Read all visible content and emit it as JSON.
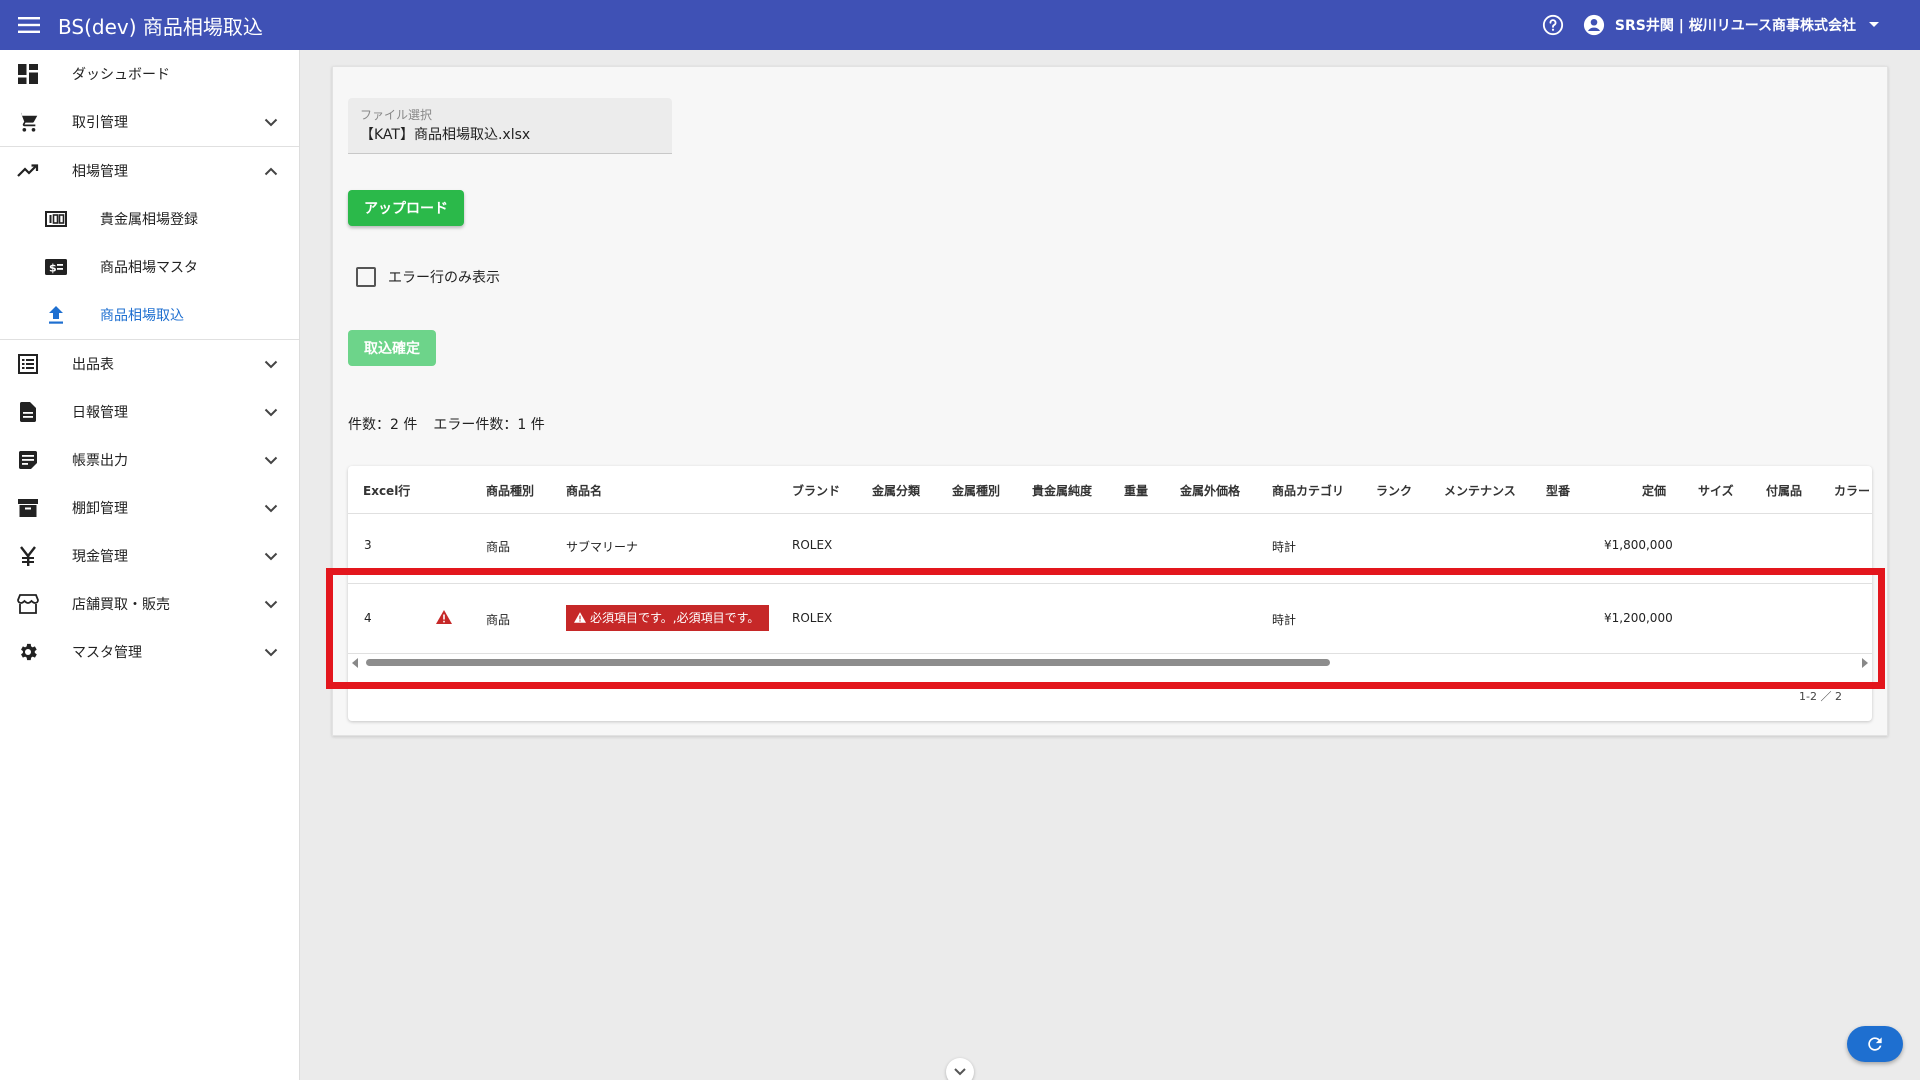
{
  "app": {
    "title": "BS(dev) 商品相場取込",
    "user": "SRS井関 | 桜川リユース商事株式会社"
  },
  "sidebar": {
    "items": [
      {
        "label": "ダッシュボード"
      },
      {
        "label": "取引管理"
      },
      {
        "label": "相場管理"
      },
      {
        "label": "貴金属相場登録"
      },
      {
        "label": "商品相場マスタ"
      },
      {
        "label": "商品相場取込"
      },
      {
        "label": "出品表"
      },
      {
        "label": "日報管理"
      },
      {
        "label": "帳票出力"
      },
      {
        "label": "棚卸管理"
      },
      {
        "label": "現金管理"
      },
      {
        "label": "店舗買取・販売"
      },
      {
        "label": "マスタ管理"
      }
    ]
  },
  "main": {
    "file_label": "ファイル選択",
    "file_value": "【KAT】商品相場取込.xlsx",
    "upload_label": "アップロード",
    "error_only_label": "エラー行のみ表示",
    "confirm_label": "取込確定",
    "count_text": "件数：2 件",
    "error_count_text": "エラー件数：1 件",
    "pager_text": "1-2 ／ 2"
  },
  "table": {
    "headers": [
      "Excel行",
      "商品種別",
      "商品名",
      "ブランド",
      "金属分類",
      "金属種別",
      "貴金属純度",
      "重量",
      "金属外価格",
      "商品カテゴリ",
      "ランク",
      "メンテナンス",
      "型番",
      "定価",
      "サイズ",
      "付属品",
      "カラー"
    ],
    "rows": [
      {
        "excel_row": "3",
        "type": "商品",
        "name": "サブマリーナ",
        "brand": "ROLEX",
        "category": "時計",
        "price": "¥1,800,000",
        "error": ""
      },
      {
        "excel_row": "4",
        "type": "商品",
        "name": "",
        "brand": "ROLEX",
        "category": "時計",
        "price": "¥1,200,000",
        "error": "必須項目です。,必須項目です。"
      }
    ]
  },
  "colors": {
    "appbar": "#3f51b5",
    "upload": "#2bb94a",
    "confirm": "#6dd48a",
    "error": "#c62828",
    "highlight": "#e3161d",
    "active": "#1e6fd0"
  },
  "icons": [
    "menu-icon",
    "help-icon",
    "account-icon",
    "dropdown-icon",
    "dashboard-icon",
    "cart-icon",
    "trending-icon",
    "hundred-icon",
    "dollar-icon",
    "upload-icon",
    "list-icon",
    "document-icon",
    "note-icon",
    "archive-icon",
    "yen-icon",
    "store-icon",
    "gear-icon",
    "refresh-icon",
    "chevron-down-icon",
    "chevron-up-icon",
    "warning-icon"
  ]
}
